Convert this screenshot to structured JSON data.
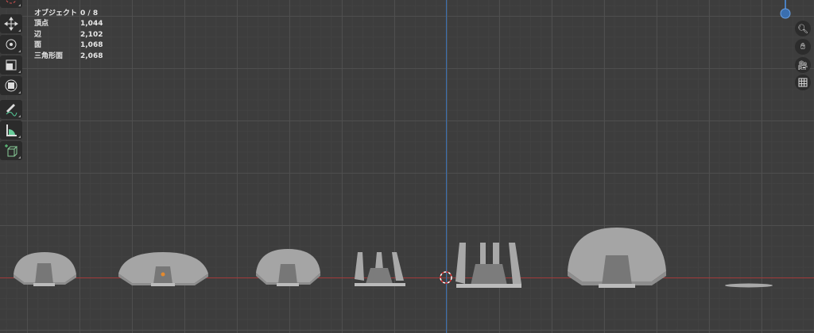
{
  "stats": [
    {
      "label": "オブジェクト",
      "value": "0 / 8"
    },
    {
      "label": "頂点",
      "value": "1,044"
    },
    {
      "label": "辺",
      "value": "2,102"
    },
    {
      "label": "面",
      "value": "1,068"
    },
    {
      "label": "三角形面",
      "value": "2,068"
    }
  ],
  "toolbar": [
    "cursor",
    "move",
    "rotate",
    "scale",
    "transform",
    "annotate",
    "measure",
    "add-cube"
  ],
  "nav": [
    "zoom",
    "pan",
    "camera",
    "ortho-grid"
  ],
  "colors": {
    "x_axis": "#a33a3a",
    "y_axis": "#3a6fb0",
    "background": "#3d3d3d"
  }
}
